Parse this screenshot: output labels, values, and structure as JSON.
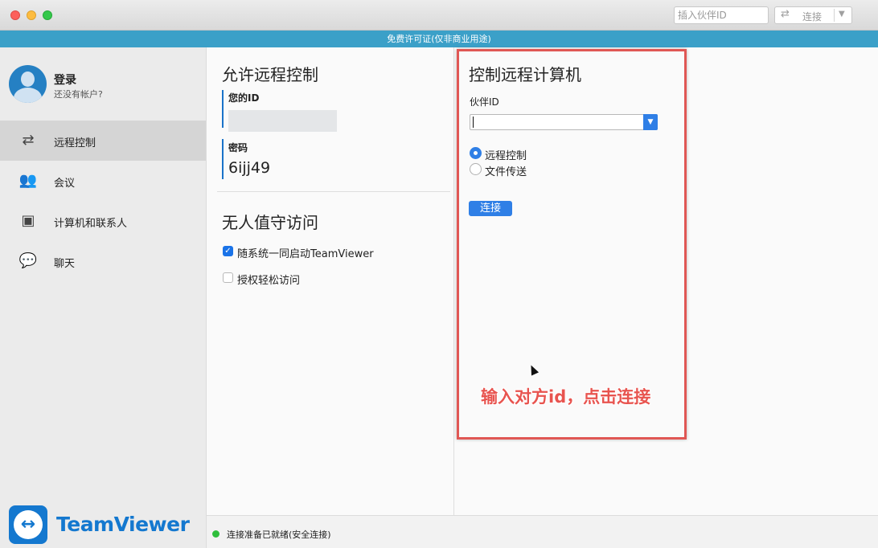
{
  "toolbar": {
    "partner_id_placeholder": "插入伙伴ID",
    "connect_label": "连接"
  },
  "license_banner": "免费许可证(仅非商业用途)",
  "account": {
    "login_title": "登录",
    "login_subtitle": "还没有帐户?"
  },
  "sidebar": {
    "items": [
      {
        "label": "远程控制",
        "icon": "arrows-exchange-icon",
        "active": true
      },
      {
        "label": "会议",
        "icon": "group-people-icon",
        "active": false
      },
      {
        "label": "计算机和联系人",
        "icon": "contact-card-icon",
        "active": false
      },
      {
        "label": "聊天",
        "icon": "chat-bubbles-icon",
        "active": false
      }
    ],
    "logo_text": "TeamViewer"
  },
  "allow_remote": {
    "title": "允许远程控制",
    "your_id_label": "您的ID",
    "password_label": "密码",
    "password_value": "6ijj49"
  },
  "unattended": {
    "title": "无人值守访问",
    "start_with_system": {
      "label": "随系统一同启动TeamViewer",
      "checked": true
    },
    "grant_easy_access": {
      "label": "授权轻松访问",
      "checked": false
    }
  },
  "control_remote": {
    "title": "控制远程计算机",
    "partner_id_label": "伙伴ID",
    "partner_id_value": "",
    "modes": [
      {
        "label": "远程控制",
        "selected": true
      },
      {
        "label": "文件传送",
        "selected": false
      }
    ],
    "connect_button": "连接"
  },
  "annotation": "输入对方id，点击连接",
  "status": {
    "text": "连接准备已就绪(安全连接)",
    "color": "#2fbe3c"
  },
  "colors": {
    "accent": "#2f7fe6",
    "license_bar": "#3ba0c8",
    "highlight": "#e05754",
    "brand": "#1478cf"
  }
}
